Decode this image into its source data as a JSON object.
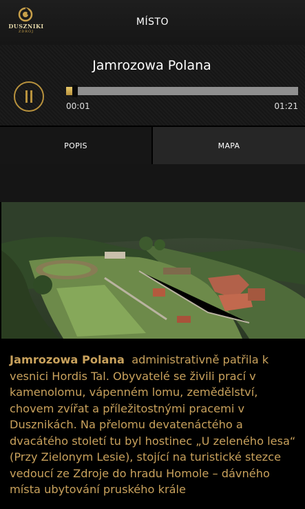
{
  "header": {
    "logo_text": "DUSZNIKI",
    "logo_sub": "ZDRÓJ",
    "title": "MÍSTO"
  },
  "player": {
    "track_title": "Jamrozowa Polana",
    "elapsed": "00:01",
    "total": "01:21",
    "progress_fraction": 0.012
  },
  "tabs": [
    {
      "label": "POPIS"
    },
    {
      "label": "MAPA"
    }
  ],
  "description": {
    "title": "Jamrozowa Polana",
    "text": "administrativně patřila k vesnici Hordis Tal. Obyvatelé se živili prací v kamenolomu, vápenném lomu, zemědělství, chovem zvířat a příležitostnými pracemi v Dusznikách. Na přelomu devatenáctého a dvacátého století tu byl hostinec „U zeleného lesa“ (Przy Zielonym Lesie), stojící na turistické stezce vedoucí ze Zdroje do hradu Homole – dávného místa ubytování pruského krále"
  },
  "colors": {
    "accent": "#b8923d",
    "text_gold": "#c8a15c"
  }
}
